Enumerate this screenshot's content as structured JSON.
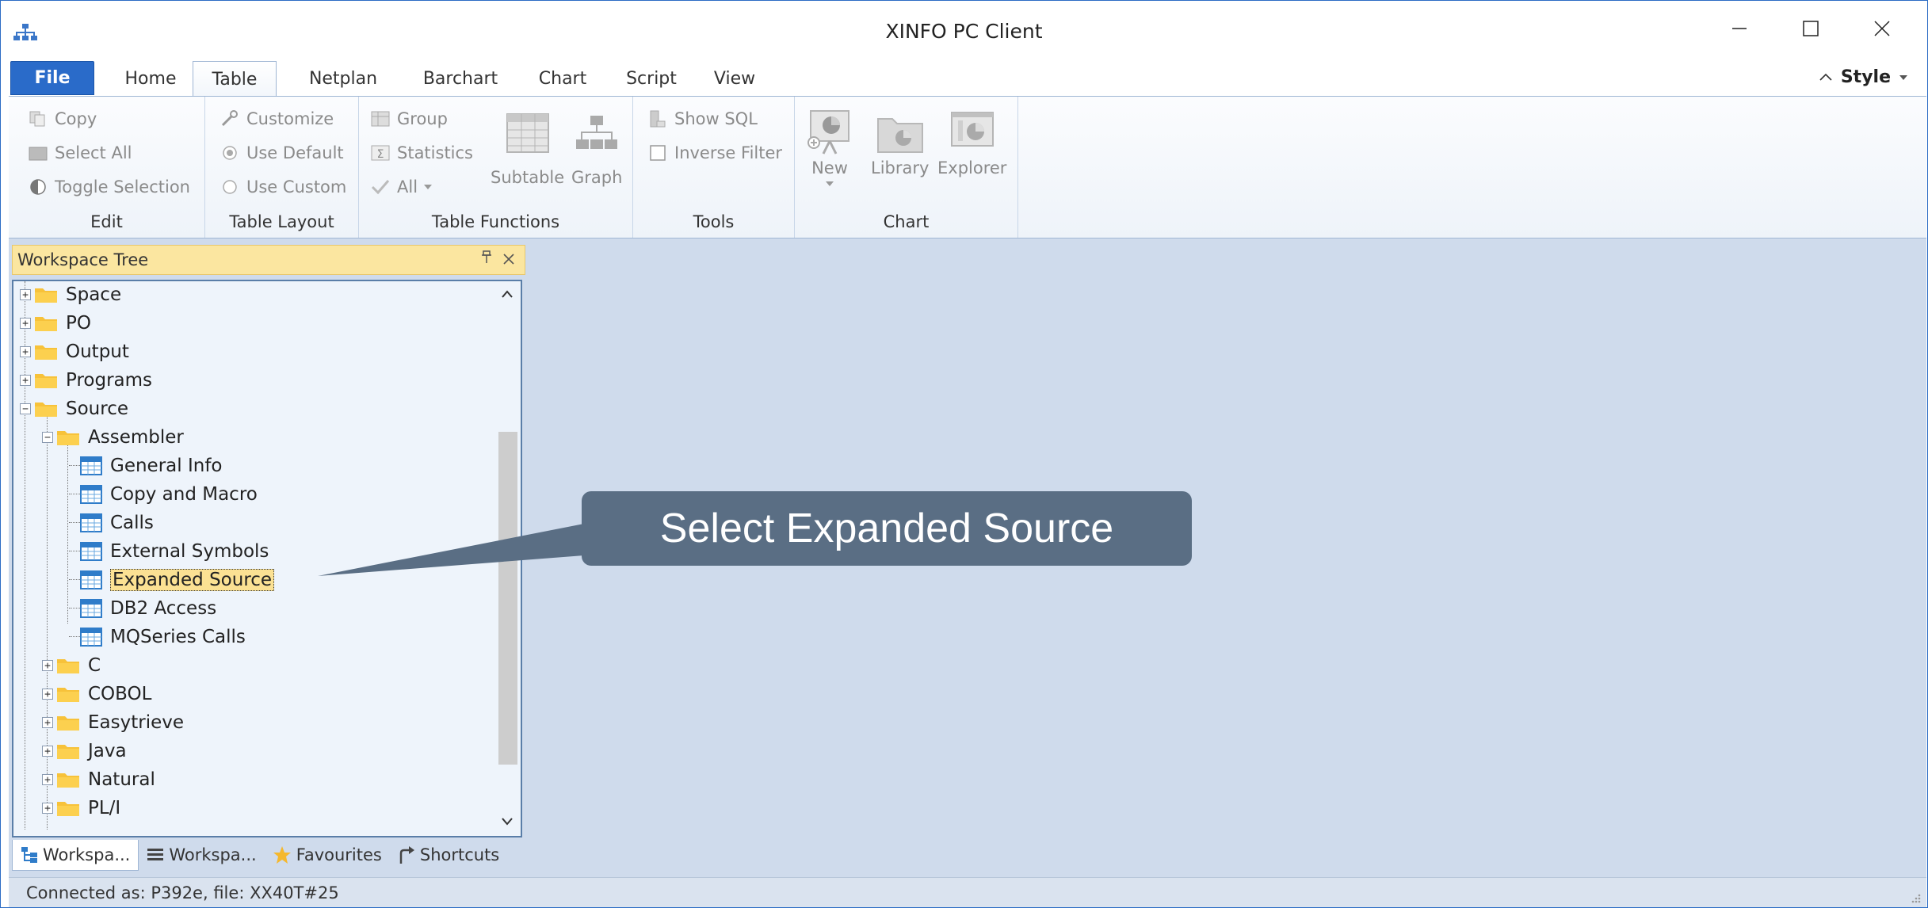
{
  "window": {
    "title": "XINFO PC Client",
    "minimize_icon": "minimize-icon",
    "maximize_icon": "maximize-icon",
    "close_icon": "close-icon"
  },
  "ribbon_tabs": [
    "File",
    "Home",
    "Table",
    "Netplan",
    "Barchart",
    "Chart",
    "Script",
    "View"
  ],
  "active_tab": "Table",
  "style_menu": "Style",
  "ribbon": {
    "edit": {
      "label": "Edit",
      "copy": "Copy",
      "select_all": "Select All",
      "toggle_selection": "Toggle Selection"
    },
    "table_layout": {
      "label": "Table Layout",
      "customize": "Customize",
      "use_default": "Use Default",
      "use_custom": "Use Custom"
    },
    "table_functions": {
      "label": "Table Functions",
      "group": "Group",
      "statistics": "Statistics",
      "all": "All",
      "subtable": "Subtable",
      "graph": "Graph"
    },
    "tools": {
      "label": "Tools",
      "show_sql": "Show SQL",
      "inverse_filter": "Inverse Filter"
    },
    "chart": {
      "label": "Chart",
      "new": "New",
      "library": "Library",
      "explorer": "Explorer"
    }
  },
  "workspace_panel": {
    "title": "Workspace Tree",
    "pin_icon": "pin-icon",
    "close_icon": "close-icon",
    "tree": {
      "space": "Space",
      "po": "PO",
      "output": "Output",
      "programs": "Programs",
      "source": "Source",
      "assembler": "Assembler",
      "general_info": "General Info",
      "copy_and_macro": "Copy and Macro",
      "calls": "Calls",
      "external_symbols": "External Symbols",
      "expanded_source": "Expanded Source",
      "db2_access": "DB2 Access",
      "mqseries_calls": "MQSeries Calls",
      "c": "C",
      "cobol": "COBOL",
      "easytrieve": "Easytrieve",
      "java": "Java",
      "natural": "Natural",
      "pli": "PL/I"
    },
    "tabs": [
      "Workspa...",
      "Workspa...",
      "Favourites",
      "Shortcuts"
    ]
  },
  "callout": "Select Expanded Source",
  "status": "Connected as: P392e, file: XX40T#25",
  "colors": {
    "file_tab": "#2a6bc9",
    "selection": "#fbe193",
    "callout": "#5a6e84",
    "workspace_bg": "#cfdbec"
  }
}
